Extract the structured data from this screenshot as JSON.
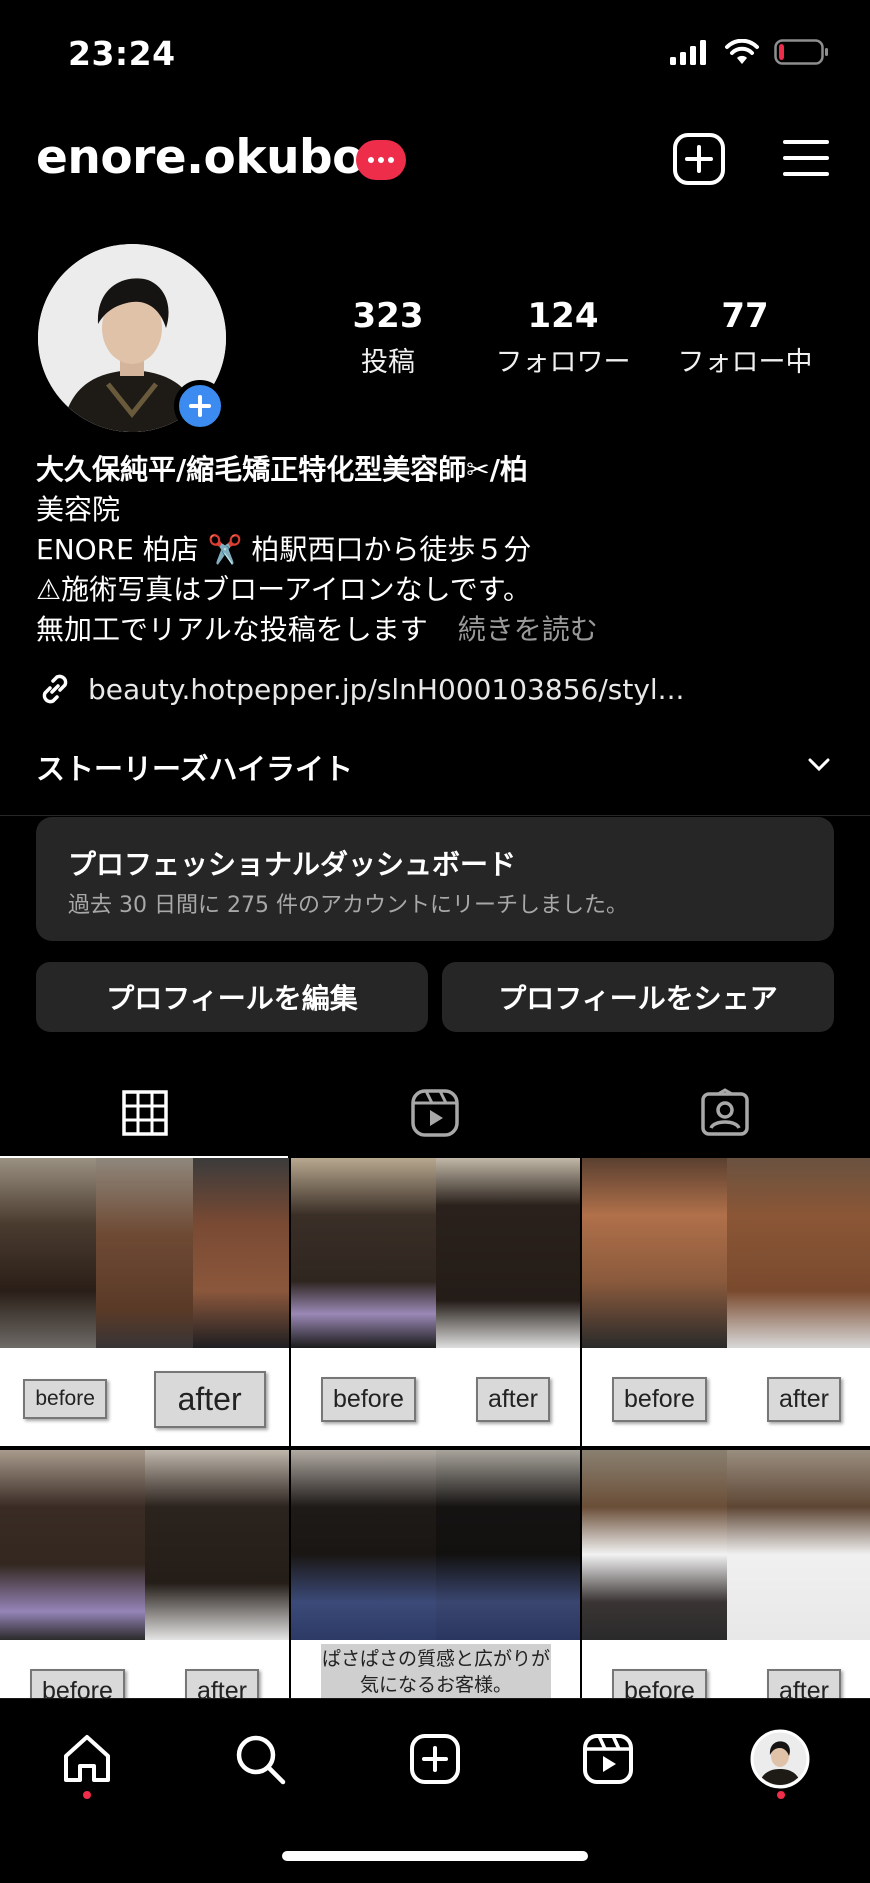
{
  "status_bar": {
    "time": "23:24",
    "battery_level": 0.12
  },
  "header": {
    "username": "enore.okubo",
    "icons": [
      "more-badge",
      "new-post-icon",
      "menu-icon"
    ]
  },
  "profile": {
    "stats": [
      {
        "value": "323",
        "label": "投稿"
      },
      {
        "value": "124",
        "label": "フォロワー"
      },
      {
        "value": "77",
        "label": "フォロー中"
      }
    ],
    "bio": {
      "name": "大久保純平/縮毛矯正特化型美容師✂︎/柏",
      "category": "美容院",
      "line1": "ENORE 柏店 ✂️ 柏駅西口から徒歩５分",
      "line2": "⚠︎施術写真はブローアイロンなしです。",
      "line3": "無加工でリアルな投稿をします",
      "more": "続きを読む"
    },
    "link": "beauty.hotpepper.jp/slnH000103856/styl..."
  },
  "highlights": {
    "label": "ストーリーズハイライト"
  },
  "dashboard": {
    "title": "プロフェッショナルダッシュボード",
    "subtitle": "過去 30 日間に 275 件のアカウントにリーチしました。"
  },
  "buttons": {
    "edit": "プロフィールを編集",
    "share": "プロフィールをシェア"
  },
  "tabs": [
    "grid-icon",
    "reels-icon",
    "tagged-icon"
  ],
  "grid": [
    {
      "before": "before",
      "after": "after"
    },
    {
      "before": "before",
      "after": "after"
    },
    {
      "before": "before",
      "after": "after"
    },
    {
      "before": "before",
      "after": "after"
    },
    {
      "caption_1": "ぱさぱさの質感と広がりが",
      "caption_2": "気になるお客様。"
    },
    {
      "before": "before",
      "after": "after"
    }
  ],
  "bottom_nav": [
    "home-icon",
    "search-icon",
    "create-icon",
    "reels-icon",
    "profile-avatar"
  ],
  "colors": {
    "background": "#000000",
    "badge": "#ed2d49",
    "add_story": "#3b8bf0",
    "surface": "#262626"
  }
}
